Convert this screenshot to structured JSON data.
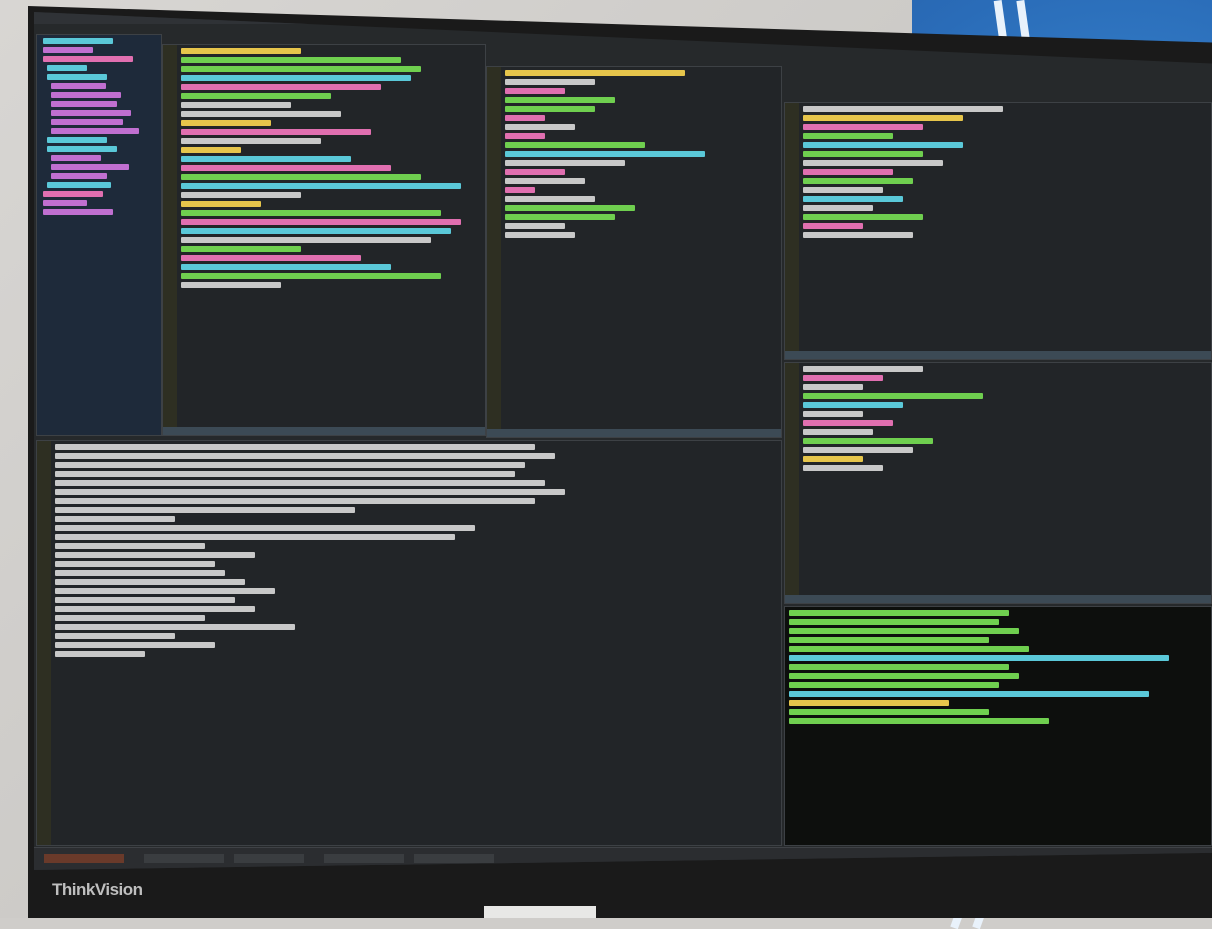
{
  "scene": {
    "monitor_brand": "ThinkVision"
  },
  "colors": {
    "accent_blue": "#2a6cb8",
    "terminal_bg": "#0d0f0d",
    "code_green": "#6fcf4f",
    "code_yellow": "#e6c54b",
    "code_cyan": "#5ac8d8",
    "code_pink": "#e06fb0"
  }
}
